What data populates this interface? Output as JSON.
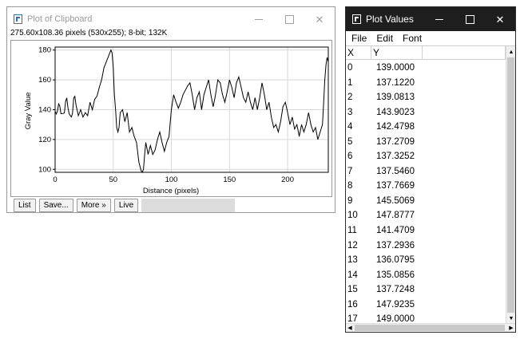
{
  "plot_window": {
    "title": "Plot of Clipboard",
    "info": "275.60x108.36 pixels (530x255); 8-bit; 132K",
    "buttons": {
      "list": "List",
      "save": "Save...",
      "more": "More »",
      "live": "Live"
    }
  },
  "values_window": {
    "title": "Plot Values",
    "menu": [
      "File",
      "Edit",
      "Font"
    ],
    "columns": [
      "X",
      "Y"
    ],
    "rows": [
      {
        "x": "0",
        "y": "139.0000"
      },
      {
        "x": "1",
        "y": "137.1220"
      },
      {
        "x": "2",
        "y": "139.0813"
      },
      {
        "x": "3",
        "y": "143.9023"
      },
      {
        "x": "4",
        "y": "142.4798"
      },
      {
        "x": "5",
        "y": "137.2709"
      },
      {
        "x": "6",
        "y": "137.3252"
      },
      {
        "x": "7",
        "y": "137.5460"
      },
      {
        "x": "8",
        "y": "137.7669"
      },
      {
        "x": "9",
        "y": "145.5069"
      },
      {
        "x": "10",
        "y": "147.8777"
      },
      {
        "x": "11",
        "y": "141.4709"
      },
      {
        "x": "12",
        "y": "137.2936"
      },
      {
        "x": "13",
        "y": "136.0795"
      },
      {
        "x": "14",
        "y": "135.0856"
      },
      {
        "x": "15",
        "y": "137.7248"
      },
      {
        "x": "16",
        "y": "147.9235"
      },
      {
        "x": "17",
        "y": "149.0000"
      }
    ]
  },
  "chart_data": {
    "type": "line",
    "title": "",
    "xlabel": "Distance (pixels)",
    "ylabel": "Gray Value",
    "xlim": [
      0,
      235
    ],
    "ylim": [
      98,
      182
    ],
    "xticks": [
      0,
      50,
      100,
      150,
      200
    ],
    "yticks": [
      100,
      120,
      140,
      160,
      180
    ],
    "grid": true,
    "line_color": "#000000",
    "series": [
      {
        "x": [
          0,
          1,
          2,
          3,
          4,
          5,
          6,
          7,
          8,
          9,
          10,
          11,
          12,
          13,
          14,
          15,
          16,
          17,
          18,
          20,
          22,
          24,
          26,
          28,
          30,
          32,
          34,
          36,
          38,
          40,
          42,
          44,
          46,
          48,
          49,
          50,
          51,
          52,
          53,
          54,
          55,
          56,
          58,
          60,
          62,
          64,
          66,
          68,
          70,
          72,
          74,
          75,
          76,
          77,
          78,
          79,
          80,
          82,
          84,
          86,
          88,
          90,
          92,
          94,
          96,
          98,
          100,
          102,
          104,
          106,
          108,
          110,
          112,
          114,
          116,
          118,
          120,
          122,
          124,
          126,
          128,
          130,
          132,
          134,
          136,
          138,
          140,
          142,
          144,
          146,
          148,
          150,
          152,
          154,
          156,
          158,
          160,
          162,
          164,
          166,
          168,
          170,
          172,
          174,
          176,
          178,
          180,
          182,
          184,
          186,
          188,
          190,
          192,
          194,
          196,
          198,
          200,
          202,
          204,
          206,
          208,
          210,
          212,
          214,
          216,
          218,
          220,
          222,
          224,
          226,
          228,
          230,
          231,
          232,
          233,
          234,
          235
        ],
        "y": [
          139,
          137.1,
          139.1,
          143.9,
          142.5,
          137.3,
          137.3,
          137.5,
          137.8,
          145.5,
          147.9,
          141.5,
          137.3,
          136.1,
          135.1,
          137.7,
          147.9,
          149,
          143,
          136,
          140,
          135,
          138,
          136,
          145,
          140,
          147,
          149,
          155,
          160,
          168,
          172,
          176,
          180,
          178,
          168,
          150,
          140,
          128,
          125,
          128,
          138,
          140,
          132,
          138,
          125,
          128,
          122,
          118,
          105,
          99,
          98,
          100,
          110,
          118,
          114,
          110,
          116,
          110,
          113,
          120,
          125,
          118,
          112,
          118,
          122,
          140,
          150,
          145,
          141,
          145,
          150,
          153,
          156,
          158,
          150,
          140,
          148,
          152,
          140,
          150,
          155,
          160,
          150,
          142,
          150,
          160,
          158,
          150,
          145,
          152,
          160,
          155,
          148,
          158,
          162,
          155,
          148,
          145,
          152,
          145,
          140,
          148,
          140,
          148,
          158,
          150,
          140,
          145,
          135,
          128,
          130,
          125,
          132,
          142,
          145,
          138,
          130,
          135,
          127,
          130,
          122,
          130,
          125,
          130,
          138,
          130,
          125,
          128,
          120,
          125,
          130,
          145,
          160,
          170,
          175,
          172
        ]
      }
    ]
  }
}
